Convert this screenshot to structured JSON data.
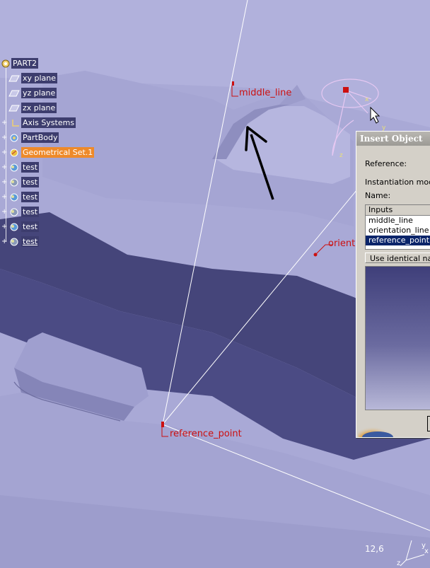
{
  "tree": {
    "root": "PART2",
    "items": [
      {
        "label": "xy plane",
        "icon": "plane-icon"
      },
      {
        "label": "yz plane",
        "icon": "plane-icon"
      },
      {
        "label": "zx plane",
        "icon": "plane-icon"
      },
      {
        "label": "Axis Systems",
        "icon": "axis-system-icon"
      },
      {
        "label": "PartBody",
        "icon": "part-body-icon"
      },
      {
        "label": "Geometrical Set.1",
        "icon": "geometrical-set-icon"
      },
      {
        "label": "test",
        "icon": "powercopy-icon"
      },
      {
        "label": "test",
        "icon": "powercopy-icon"
      },
      {
        "label": "test",
        "icon": "powercopy-icon"
      },
      {
        "label": "test",
        "icon": "powercopy-icon"
      },
      {
        "label": "test",
        "icon": "powercopy-icon"
      },
      {
        "label": "test",
        "icon": "powercopy-icon"
      }
    ]
  },
  "viewport": {
    "labels": {
      "middle_line": "middle_line",
      "reference_point": "reference_point",
      "orientation_partial": "orient"
    },
    "compass_axes": {
      "x": "x",
      "y": "y",
      "z": "z"
    },
    "zoom_readout": "12,6"
  },
  "dialog": {
    "title": "Insert Object",
    "reference_label": "Reference:",
    "instantiation_label": "Instantiation mode:",
    "name_label": "Name:",
    "inputs_header": "Inputs",
    "inputs": [
      "middle_line",
      "orientation_line",
      "reference_point"
    ],
    "selected_input": "reference_point",
    "identical_button": "Use identical name"
  },
  "colors": {
    "background": "#a9a9d6",
    "selection_orange": "#ee8a2a",
    "geometry_red": "#cc1010",
    "list_selection": "#0a246a"
  }
}
